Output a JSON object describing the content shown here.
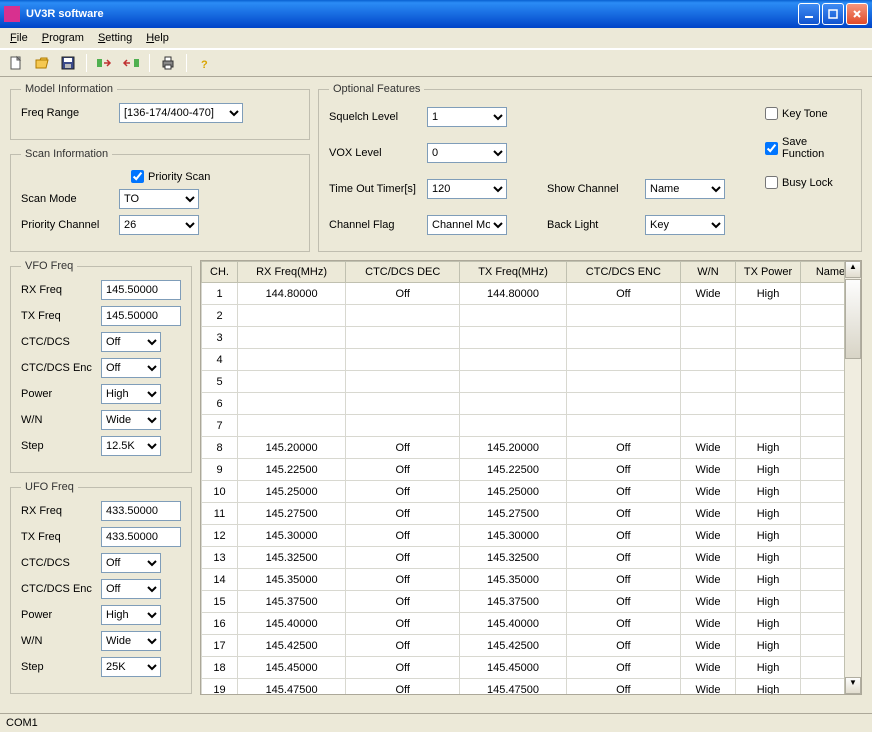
{
  "window": {
    "title": "UV3R software"
  },
  "menu": {
    "file": "File",
    "program": "Program",
    "setting": "Setting",
    "help": "Help"
  },
  "model": {
    "legend": "Model Information",
    "freqRangeLabel": "Freq Range",
    "freqRange": "[136-174/400-470]"
  },
  "scan": {
    "legend": "Scan Information",
    "priorityScanLabel": "Priority Scan",
    "priorityScan": true,
    "scanModeLabel": "Scan Mode",
    "scanMode": "TO",
    "priorityChLabel": "Priority Channel",
    "priorityCh": "26"
  },
  "opt": {
    "legend": "Optional Features",
    "squelchLabel": "Squelch Level",
    "squelch": "1",
    "voxLabel": "VOX Level",
    "vox": "0",
    "totLabel": "Time Out Timer[s]",
    "tot": "120",
    "chFlagLabel": "Channel Flag",
    "chFlag": "Channel Mode",
    "showChLabel": "Show Channel",
    "showCh": "Name",
    "backLightLabel": "Back Light",
    "backLight": "Key",
    "keyToneLabel": "Key Tone",
    "keyTone": false,
    "saveFuncLabel": "Save Function",
    "saveFunc": true,
    "busyLockLabel": "Busy Lock",
    "busyLock": false
  },
  "vfo": {
    "legend": "VFO Freq",
    "rxLabel": "RX Freq",
    "rx": "145.50000",
    "txLabel": "TX Freq",
    "tx": "145.50000",
    "ctcLabel": "CTC/DCS",
    "ctc": "Off",
    "ctcEncLabel": "CTC/DCS Enc",
    "ctcEnc": "Off",
    "powerLabel": "Power",
    "power": "High",
    "wnLabel": "W/N",
    "wn": "Wide",
    "stepLabel": "Step",
    "step": "12.5K"
  },
  "ufo": {
    "legend": "UFO Freq",
    "rxLabel": "RX Freq",
    "rx": "433.50000",
    "txLabel": "TX Freq",
    "tx": "433.50000",
    "ctcLabel": "CTC/DCS",
    "ctc": "Off",
    "ctcEncLabel": "CTC/DCS Enc",
    "ctcEnc": "Off",
    "powerLabel": "Power",
    "power": "High",
    "wnLabel": "W/N",
    "wn": "Wide",
    "stepLabel": "Step",
    "step": "25K"
  },
  "table": {
    "headers": {
      "ch": "CH.",
      "rx": "RX Freq(MHz)",
      "dec": "CTC/DCS DEC",
      "tx": "TX Freq(MHz)",
      "enc": "CTC/DCS ENC",
      "wn": "W/N",
      "pwr": "TX Power",
      "name": "Name"
    },
    "rows": [
      {
        "ch": "1",
        "rx": "144.80000",
        "dec": "Off",
        "tx": "144.80000",
        "enc": "Off",
        "wn": "Wide",
        "pwr": "High",
        "name": ""
      },
      {
        "ch": "2",
        "rx": "",
        "dec": "",
        "tx": "",
        "enc": "",
        "wn": "",
        "pwr": "",
        "name": ""
      },
      {
        "ch": "3",
        "rx": "",
        "dec": "",
        "tx": "",
        "enc": "",
        "wn": "",
        "pwr": "",
        "name": ""
      },
      {
        "ch": "4",
        "rx": "",
        "dec": "",
        "tx": "",
        "enc": "",
        "wn": "",
        "pwr": "",
        "name": ""
      },
      {
        "ch": "5",
        "rx": "",
        "dec": "",
        "tx": "",
        "enc": "",
        "wn": "",
        "pwr": "",
        "name": ""
      },
      {
        "ch": "6",
        "rx": "",
        "dec": "",
        "tx": "",
        "enc": "",
        "wn": "",
        "pwr": "",
        "name": ""
      },
      {
        "ch": "7",
        "rx": "",
        "dec": "",
        "tx": "",
        "enc": "",
        "wn": "",
        "pwr": "",
        "name": ""
      },
      {
        "ch": "8",
        "rx": "145.20000",
        "dec": "Off",
        "tx": "145.20000",
        "enc": "Off",
        "wn": "Wide",
        "pwr": "High",
        "name": ""
      },
      {
        "ch": "9",
        "rx": "145.22500",
        "dec": "Off",
        "tx": "145.22500",
        "enc": "Off",
        "wn": "Wide",
        "pwr": "High",
        "name": ""
      },
      {
        "ch": "10",
        "rx": "145.25000",
        "dec": "Off",
        "tx": "145.25000",
        "enc": "Off",
        "wn": "Wide",
        "pwr": "High",
        "name": ""
      },
      {
        "ch": "11",
        "rx": "145.27500",
        "dec": "Off",
        "tx": "145.27500",
        "enc": "Off",
        "wn": "Wide",
        "pwr": "High",
        "name": ""
      },
      {
        "ch": "12",
        "rx": "145.30000",
        "dec": "Off",
        "tx": "145.30000",
        "enc": "Off",
        "wn": "Wide",
        "pwr": "High",
        "name": ""
      },
      {
        "ch": "13",
        "rx": "145.32500",
        "dec": "Off",
        "tx": "145.32500",
        "enc": "Off",
        "wn": "Wide",
        "pwr": "High",
        "name": ""
      },
      {
        "ch": "14",
        "rx": "145.35000",
        "dec": "Off",
        "tx": "145.35000",
        "enc": "Off",
        "wn": "Wide",
        "pwr": "High",
        "name": ""
      },
      {
        "ch": "15",
        "rx": "145.37500",
        "dec": "Off",
        "tx": "145.37500",
        "enc": "Off",
        "wn": "Wide",
        "pwr": "High",
        "name": ""
      },
      {
        "ch": "16",
        "rx": "145.40000",
        "dec": "Off",
        "tx": "145.40000",
        "enc": "Off",
        "wn": "Wide",
        "pwr": "High",
        "name": ""
      },
      {
        "ch": "17",
        "rx": "145.42500",
        "dec": "Off",
        "tx": "145.42500",
        "enc": "Off",
        "wn": "Wide",
        "pwr": "High",
        "name": ""
      },
      {
        "ch": "18",
        "rx": "145.45000",
        "dec": "Off",
        "tx": "145.45000",
        "enc": "Off",
        "wn": "Wide",
        "pwr": "High",
        "name": ""
      },
      {
        "ch": "19",
        "rx": "145.47500",
        "dec": "Off",
        "tx": "145.47500",
        "enc": "Off",
        "wn": "Wide",
        "pwr": "High",
        "name": ""
      }
    ]
  },
  "status": {
    "port": "COM1"
  }
}
